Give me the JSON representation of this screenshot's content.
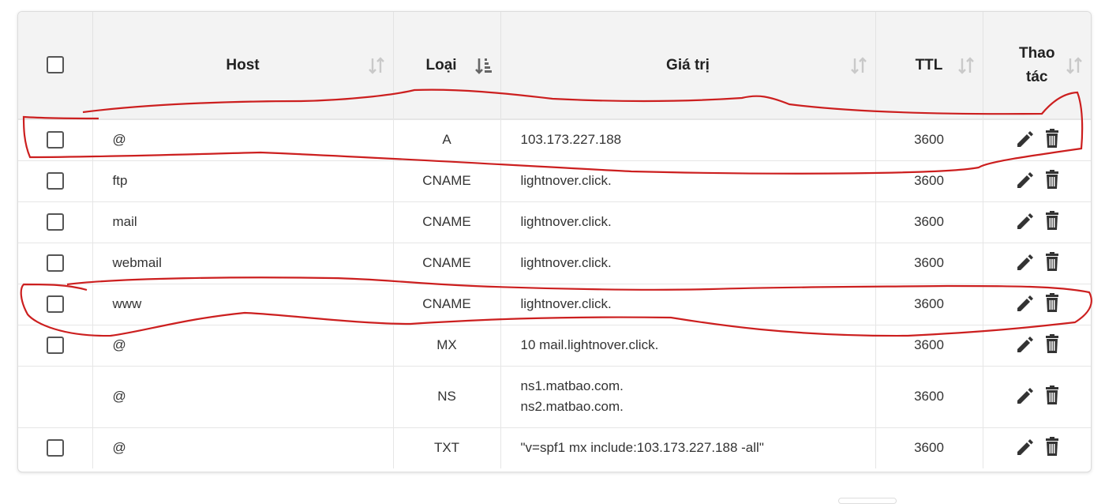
{
  "table": {
    "headers": {
      "host": "Host",
      "type": "Loại",
      "value": "Giá trị",
      "ttl": "TTL",
      "actions_line1": "Thao",
      "actions_line2": "tác"
    },
    "rows": [
      {
        "host": "@",
        "type": "A",
        "value": "103.173.227.188",
        "ttl": "3600",
        "has_checkbox": true
      },
      {
        "host": "ftp",
        "type": "CNAME",
        "value": "lightnover.click.",
        "ttl": "3600",
        "has_checkbox": true
      },
      {
        "host": "mail",
        "type": "CNAME",
        "value": "lightnover.click.",
        "ttl": "3600",
        "has_checkbox": true
      },
      {
        "host": "webmail",
        "type": "CNAME",
        "value": "lightnover.click.",
        "ttl": "3600",
        "has_checkbox": true
      },
      {
        "host": "www",
        "type": "CNAME",
        "value": "lightnover.click.",
        "ttl": "3600",
        "has_checkbox": true
      },
      {
        "host": "@",
        "type": "MX",
        "value": "10 mail.lightnover.click.",
        "ttl": "3600",
        "has_checkbox": true
      },
      {
        "host": "@",
        "type": "NS",
        "value": "ns1.matbao.com.",
        "value2": "ns2.matbao.com.",
        "ttl": "3600",
        "has_checkbox": false
      },
      {
        "host": "@",
        "type": "TXT",
        "value": "\"v=spf1 mx include:103.173.227.188 -all\"",
        "ttl": "3600",
        "has_checkbox": true
      }
    ]
  },
  "icons": {
    "edit": "pencil-icon",
    "delete": "trash-icon",
    "sort": "sort-arrows-icon",
    "sort_active": "sort-amount-down-icon"
  },
  "colors": {
    "header_bg": "#f3f3f3",
    "annotation": "#cc1f1f",
    "icon": "#333333"
  }
}
